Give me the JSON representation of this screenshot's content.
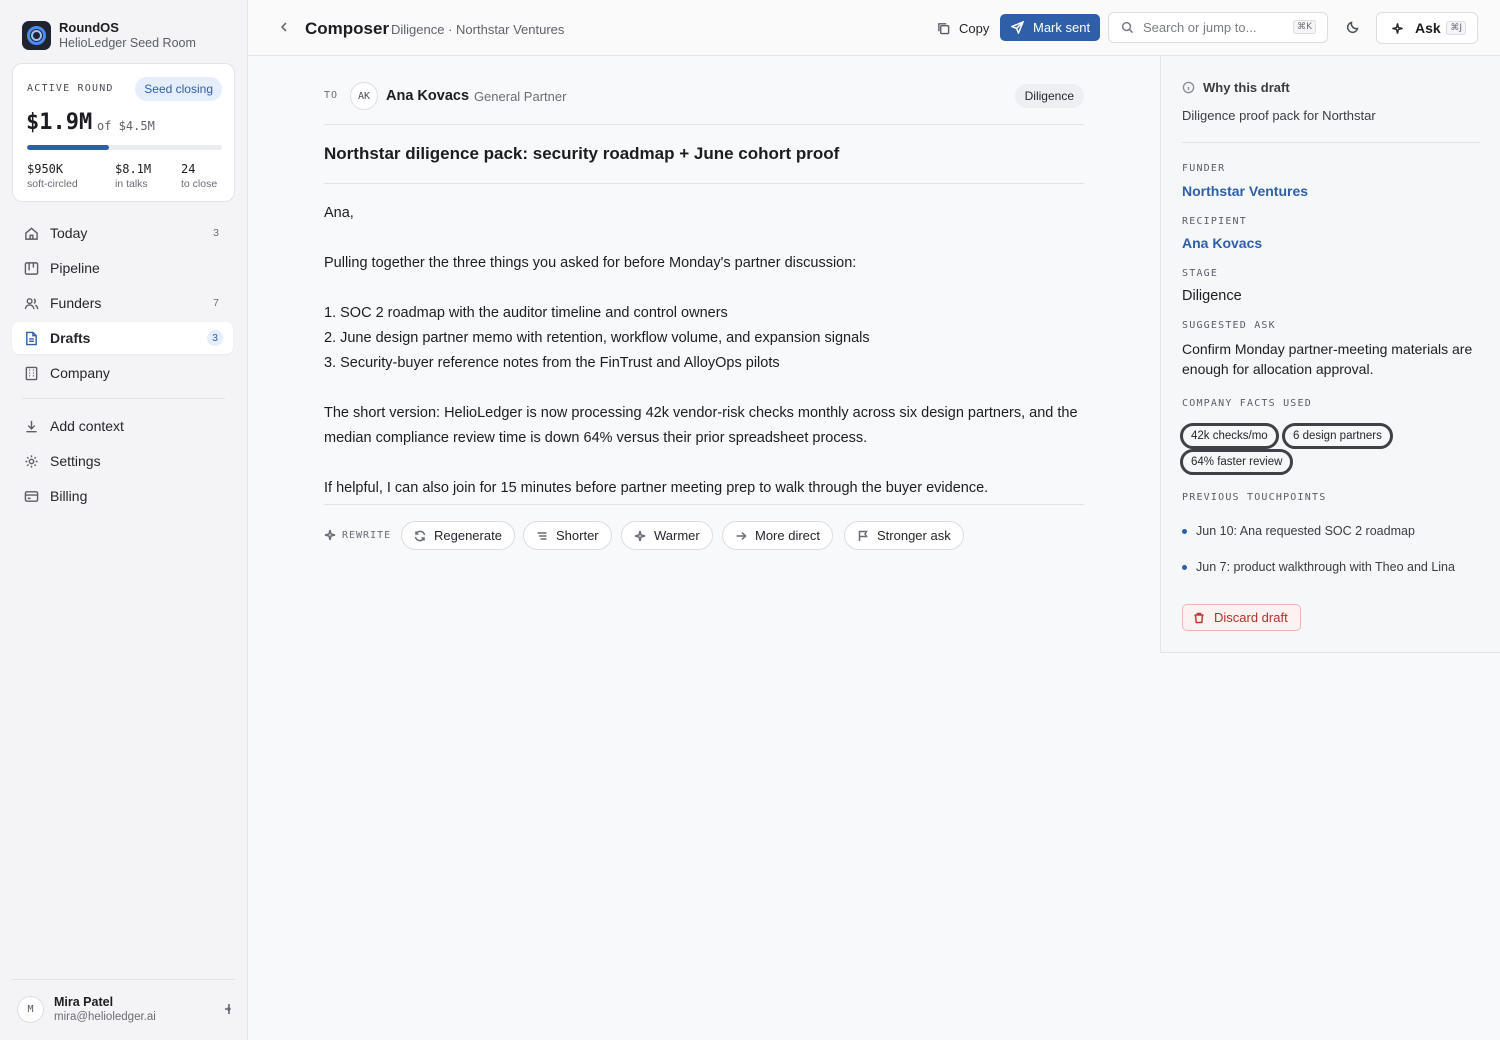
{
  "brand": {
    "name": "RoundOS",
    "room": "HelioLedger Seed Room"
  },
  "round": {
    "label": "ACTIVE ROUND",
    "badge": "Seed closing",
    "amount": "$1.9M",
    "of": "of $4.5M",
    "progress_pct": 42,
    "stats": [
      {
        "value": "$950K",
        "label": "soft-circled"
      },
      {
        "value": "$8.1M",
        "label": "in talks"
      },
      {
        "value": "24",
        "label": "to close"
      }
    ]
  },
  "nav": [
    {
      "label": "Today",
      "count": "3",
      "icon": "home-icon"
    },
    {
      "label": "Pipeline",
      "count": "",
      "icon": "kanban-icon"
    },
    {
      "label": "Funders",
      "count": "7",
      "icon": "users-icon"
    },
    {
      "label": "Drafts",
      "count": "3",
      "icon": "file-icon",
      "active": true
    },
    {
      "label": "Company",
      "count": "",
      "icon": "building-icon"
    }
  ],
  "nav_secondary": [
    {
      "label": "Add context",
      "icon": "download-icon"
    },
    {
      "label": "Settings",
      "icon": "gear-icon"
    },
    {
      "label": "Billing",
      "icon": "credit-card-icon"
    }
  ],
  "user": {
    "initial": "M",
    "name": "Mira Patel",
    "email": "mira@helioledger.ai"
  },
  "topbar": {
    "title": "Composer",
    "breadcrumb": "Diligence · Northstar Ventures",
    "copy_label": "Copy",
    "mark_sent_label": "Mark sent",
    "search_placeholder": "Search or jump to...",
    "search_kbd": "⌘K",
    "ask_label": "Ask",
    "ask_kbd": "⌘J"
  },
  "composer": {
    "to_label": "TO",
    "recipient_initials": "AK",
    "recipient_name": "Ana Kovacs",
    "recipient_role": "· General Partner",
    "stage_tag": "Diligence",
    "subject": "Northstar diligence pack: security roadmap + June cohort proof",
    "greeting": "Ana,",
    "intro": "Pulling together the three things you asked for before Monday's partner discussion:",
    "list": [
      "1. SOC 2 roadmap with the auditor timeline and control owners",
      "2. June design partner memo with retention, workflow volume, and expansion signals",
      "3. Security-buyer reference notes from the FinTrust and AlloyOps pilots"
    ],
    "summary": "The short version: HelioLedger is now processing 42k vendor-risk checks monthly across six design partners, and the median compliance review time is down 64% versus their prior spreadsheet process.",
    "closing": "If helpful, I can also join for 15 minutes before partner meeting prep to walk through the buyer evidence.",
    "rewrite_label": "REWRITE",
    "rewrite_actions": [
      "Regenerate",
      "Shorter",
      "Warmer",
      "More direct",
      "Stronger ask"
    ]
  },
  "panel": {
    "why_title": "Why this draft",
    "why_desc": "Diligence proof pack for Northstar",
    "funder_label": "FUNDER",
    "funder": "Northstar Ventures",
    "recipient_label": "RECIPIENT",
    "recipient": "Ana Kovacs",
    "stage_label": "STAGE",
    "stage": "Diligence",
    "ask_label": "SUGGESTED ASK",
    "ask": "Confirm Monday partner-meeting materials are enough for allocation approval.",
    "facts_label": "COMPANY FACTS USED",
    "facts": [
      "42k checks/mo",
      "6 design partners",
      "64% faster review"
    ],
    "touchpoints_label": "PREVIOUS TOUCHPOINTS",
    "touchpoints": [
      "Jun 10: Ana requested SOC 2 roadmap",
      "Jun 7: product walkthrough with Theo and Lina"
    ],
    "discard_label": "Discard draft"
  },
  "colors": {
    "accent": "#2f5fa8",
    "danger": "#b0322a"
  }
}
